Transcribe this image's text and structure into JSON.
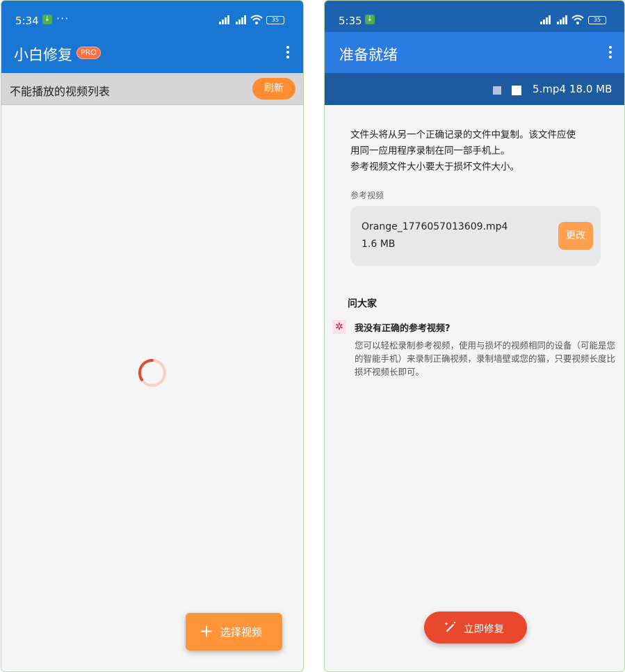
{
  "left_screen": {
    "status": {
      "time": "5:34",
      "dots": "···",
      "battery": "35"
    },
    "appbar": {
      "title": "小白修复",
      "badge": "PRO"
    },
    "list": {
      "header": "不能播放的视频列表",
      "refresh_label": "刷新"
    },
    "fab": {
      "plus": "+",
      "label": "选择视频"
    }
  },
  "right_screen": {
    "status": {
      "time": "5:35",
      "battery": "35"
    },
    "appbar": {
      "title": "准备就绪"
    },
    "file": {
      "name": "5.mp4",
      "size": "18.0 MB"
    },
    "description": {
      "line1": "文件头将从另一个正确记录的文件中复制。该文件应使",
      "line2": "用同一应用程序录制在同一部手机上。",
      "line3": "参考视频文件大小要大于损坏文件大小。"
    },
    "reference": {
      "label": "参考视频",
      "file_name": "Orange_1776057013609.mp4",
      "file_size": "1.6 MB",
      "change_label": "更改"
    },
    "faq": {
      "heading": "问大家",
      "question": "我没有正确的参考视频?",
      "answer": "您可以轻松录制参考视频，使用与损坏的视频相同的设备（可能是您的智能手机）来录制正确视频，录制墙壁或您的猫，只要视频长度比损坏视频长即可。"
    },
    "repair_button": {
      "label": "立即修复"
    }
  },
  "colors": {
    "left_header": "#1976d2",
    "right_status": "#1d62b0",
    "right_appbar": "#2b7be0",
    "file_bar": "#1e5aa0",
    "orange_accent": "#ff8c30",
    "repair_red": "#e8482c"
  },
  "icons": [
    "download-icon",
    "signal-icon",
    "wifi-icon",
    "battery-icon",
    "more-vert-icon",
    "spinner-icon",
    "plus-icon",
    "gear-icon",
    "magic-wand-icon"
  ]
}
